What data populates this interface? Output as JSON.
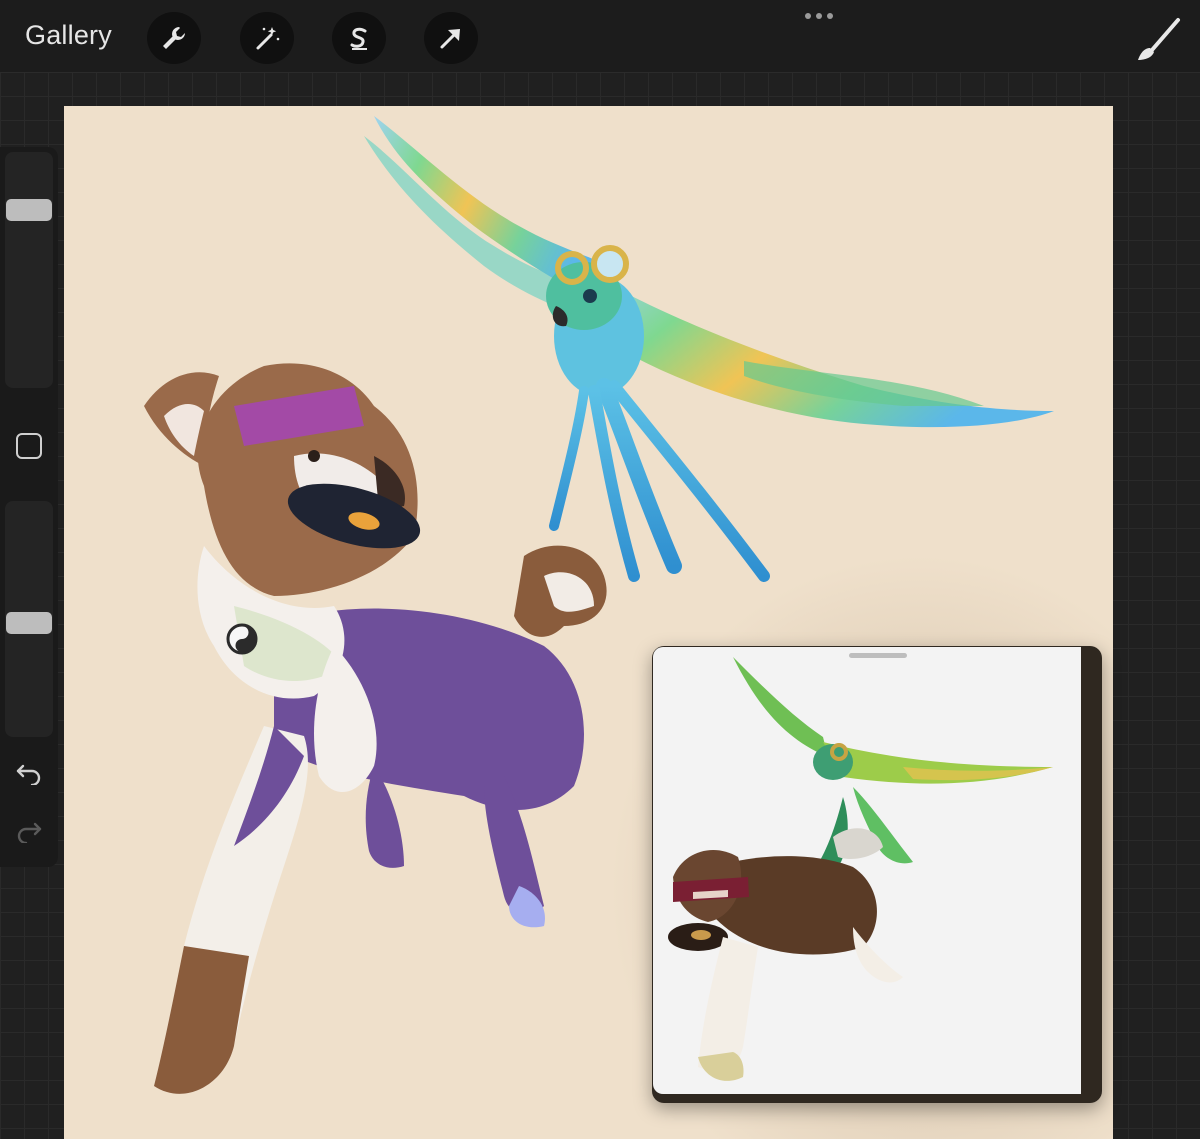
{
  "topbar": {
    "gallery_label": "Gallery",
    "tools": [
      "wrench-icon",
      "magic-wand-icon",
      "selection-s-icon",
      "transform-arrow-icon"
    ],
    "more": "more-dots-icon",
    "brush": "brush-icon"
  },
  "sidebar": {
    "brush_size_level": 0.22,
    "opacity_level": 0.52,
    "modify_button": "square-icon",
    "undo": "undo-icon",
    "redo": "redo-icon"
  },
  "colors": {
    "canvas_background": "#efe0cb",
    "ui_dark": "#1c1c1c",
    "reference_background": "#f3f3f3"
  }
}
